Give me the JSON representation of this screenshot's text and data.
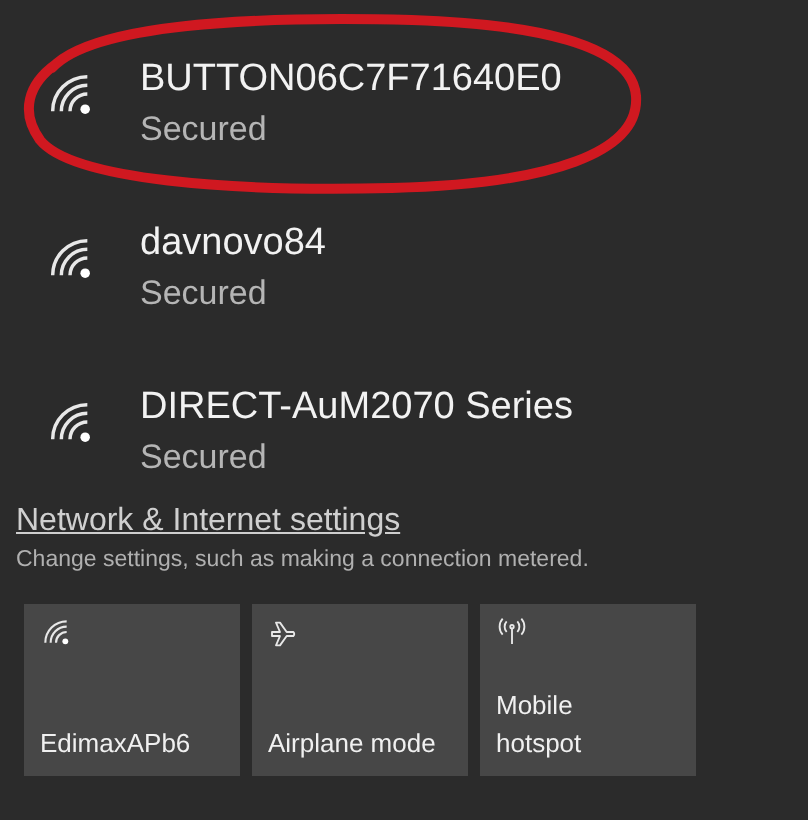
{
  "networks": [
    {
      "name": "BUTTON06C7F71640E0",
      "status": "Secured",
      "highlighted": true
    },
    {
      "name": "davnovo84",
      "status": "Secured",
      "highlighted": false
    },
    {
      "name": "DIRECT-AuM2070 Series",
      "status": "Secured",
      "highlighted": false
    }
  ],
  "settings_link": "Network & Internet settings",
  "settings_caption": "Change settings, such as making a connection metered.",
  "tiles": [
    {
      "kind": "wifi",
      "label": "EdimaxAPb6"
    },
    {
      "kind": "airplane",
      "label": "Airplane mode"
    },
    {
      "kind": "hotspot",
      "label": "Mobile\nhotspot"
    }
  ]
}
